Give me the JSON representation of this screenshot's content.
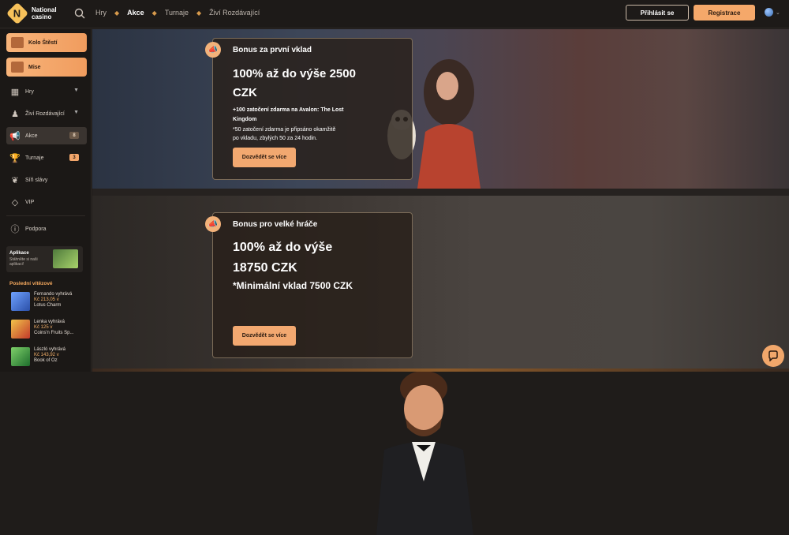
{
  "brand": {
    "line1": "National",
    "line2": "casino",
    "mark": "N"
  },
  "nav": {
    "items": [
      {
        "label": "Hry"
      },
      {
        "label": "Akce"
      },
      {
        "label": "Turnaje"
      },
      {
        "label": "Živí Rozdávající"
      }
    ]
  },
  "header": {
    "login_label": "Přihlásit se",
    "register_label": "Registrace"
  },
  "sidebar": {
    "wheel_label": "Kolo Štěstí",
    "missions_label": "Mise",
    "items": [
      {
        "label": "Hry"
      },
      {
        "label": "Živí Rozdávající"
      },
      {
        "label": "Akce",
        "badge": "8"
      },
      {
        "label": "Turnaje",
        "badge": "3"
      },
      {
        "label": "Síň slávy"
      },
      {
        "label": "VIP"
      },
      {
        "label": "Podpora"
      }
    ],
    "app": {
      "title": "Aplikace",
      "subtitle": "Stáhněte si naši aplikaci!"
    },
    "winners_title": "Poslední vítězové",
    "winners": [
      {
        "name": "Fernando vyhrává",
        "amount": "Kč 213,05 v",
        "game": "Lotus Charm",
        "color": "#3f6bd0"
      },
      {
        "name": "Lenka vyhrává",
        "amount": "Kč 125 v",
        "game": "Coins'n Fruits Sp...",
        "color": "#c9402f"
      },
      {
        "name": "László vyhrává",
        "amount": "Kč 143,92 v",
        "game": "Book of Oz",
        "color": "#2f8a3a"
      }
    ]
  },
  "promos": [
    {
      "label": "Bonus za první vklad",
      "head1": "100% až do výše 2500",
      "head2": "CZK",
      "line1": "+100 zatočení zdarma na Avalon: The Lost",
      "line2": "Kingdom",
      "line3": "*50 zatočení zdarma je připsáno okamžitě",
      "line4": "po vkladu, zbylých 50 za 24 hodin.",
      "cta": "Dozvědět se více"
    },
    {
      "label": "Bonus pro velké hráče",
      "head1": "100% až do výše",
      "head2": "18750 CZK",
      "head3": "*Minimální vklad 7500 CZK",
      "cta": "Dozvědět se více"
    }
  ],
  "colors": {
    "accent": "#f5a86a",
    "gold": "#f6c15a",
    "bg": "#1f1c1a"
  }
}
